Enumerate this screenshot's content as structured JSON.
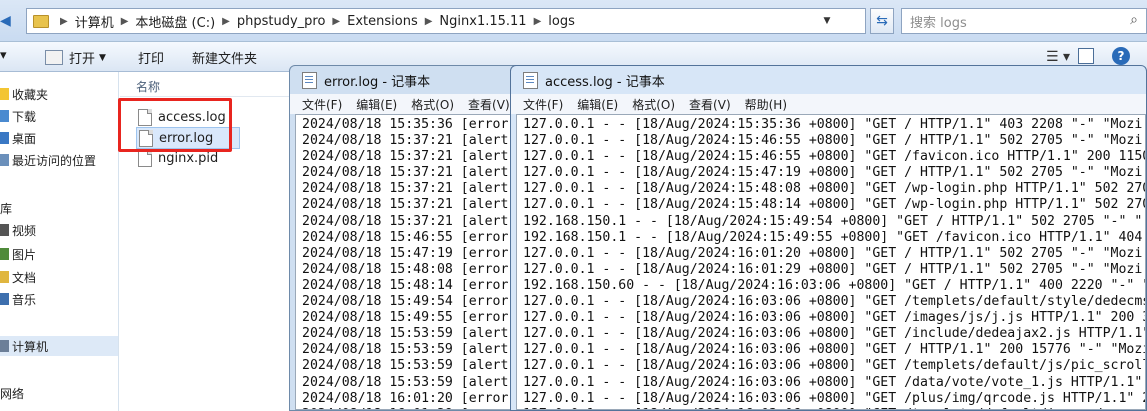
{
  "explorer": {
    "breadcrumb": [
      "计算机",
      "本地磁盘 (C:)",
      "phpstudy_pro",
      "Extensions",
      "Nginx1.15.11",
      "logs"
    ],
    "search_placeholder": "搜索 logs",
    "toolbar": {
      "open": "打开",
      "print": "打印",
      "new_folder": "新建文件夹"
    },
    "nav": {
      "favorites": "收藏夹",
      "downloads": "下载",
      "desktop": "桌面",
      "recent": "最近访问的位置",
      "libraries": "库",
      "videos": "视频",
      "pictures": "图片",
      "documents": "文档",
      "music": "音乐",
      "computer": "计算机",
      "network": "网络"
    },
    "column_name": "名称",
    "files": [
      "access.log",
      "error.log",
      "nginx.pid"
    ],
    "selected_file": "error.log"
  },
  "error_window": {
    "title": "error.log - 记事本",
    "menu": [
      "文件(F)",
      "编辑(E)",
      "格式(O)",
      "查看(V)"
    ],
    "lines": [
      "2024/08/18 15:35:36 [error]",
      "2024/08/18 15:37:21 [alert]",
      "2024/08/18 15:37:21 [alert]",
      "2024/08/18 15:37:21 [alert]",
      "2024/08/18 15:37:21 [alert]",
      "2024/08/18 15:37:21 [alert]",
      "2024/08/18 15:37:21 [alert]",
      "2024/08/18 15:46:55 [error]",
      "2024/08/18 15:47:19 [error]",
      "2024/08/18 15:48:08 [error]",
      "2024/08/18 15:48:14 [error]",
      "2024/08/18 15:49:54 [error]",
      "2024/08/18 15:49:55 [error]",
      "2024/08/18 15:53:59 [alert]",
      "2024/08/18 15:53:59 [alert]",
      "2024/08/18 15:53:59 [alert]",
      "2024/08/18 15:53:59 [alert]",
      "2024/08/18 16:01:20 [error]",
      "2024/08/18 16:01:29 [error]"
    ]
  },
  "access_window": {
    "title": "access.log - 记事本",
    "menu": [
      "文件(F)",
      "编辑(E)",
      "格式(O)",
      "查看(V)",
      "帮助(H)"
    ],
    "lines": [
      "127.0.0.1 - - [18/Aug/2024:15:35:36 +0800] \"GET / HTTP/1.1\" 403 2208 \"-\" \"Mozi",
      "127.0.0.1 - - [18/Aug/2024:15:46:55 +0800] \"GET / HTTP/1.1\" 502 2705 \"-\" \"Mozi",
      "127.0.0.1 - - [18/Aug/2024:15:46:55 +0800] \"GET /favicon.ico HTTP/1.1\" 200 1150",
      "127.0.0.1 - - [18/Aug/2024:15:47:19 +0800] \"GET / HTTP/1.1\" 502 2705 \"-\" \"Mozi",
      "127.0.0.1 - - [18/Aug/2024:15:48:08 +0800] \"GET /wp-login.php HTTP/1.1\" 502 270",
      "127.0.0.1 - - [18/Aug/2024:15:48:14 +0800] \"GET /wp-login.php HTTP/1.1\" 502 270",
      "192.168.150.1 - - [18/Aug/2024:15:49:54 +0800] \"GET / HTTP/1.1\" 502 2705 \"-\" \"",
      "192.168.150.1 - - [18/Aug/2024:15:49:55 +0800] \"GET /favicon.ico HTTP/1.1\" 404",
      "127.0.0.1 - - [18/Aug/2024:16:01:20 +0800] \"GET / HTTP/1.1\" 502 2705 \"-\" \"Mozi",
      "127.0.0.1 - - [18/Aug/2024:16:01:29 +0800] \"GET / HTTP/1.1\" 502 2705 \"-\" \"Mozi",
      "192.168.150.60 - - [18/Aug/2024:16:03:06 +0800] \"GET / HTTP/1.1\" 400 2220 \"-\" \"",
      "127.0.0.1 - - [18/Aug/2024:16:03:06 +0800] \"GET /templets/default/style/dedecms",
      "127.0.0.1 - - [18/Aug/2024:16:03:06 +0800] \"GET /images/js/j.js HTTP/1.1\" 200 3",
      "127.0.0.1 - - [18/Aug/2024:16:03:06 +0800] \"GET /include/dedeajax2.js HTTP/1.1\"",
      "127.0.0.1 - - [18/Aug/2024:16:03:06 +0800] \"GET / HTTP/1.1\" 200 15776 \"-\" \"Mozi",
      "127.0.0.1 - - [18/Aug/2024:16:03:06 +0800] \"GET /templets/default/js/pic_scroll",
      "127.0.0.1 - - [18/Aug/2024:16:03:06 +0800] \"GET /data/vote/vote_1.js HTTP/1.1\"",
      "127.0.0.1 - - [18/Aug/2024:16:03:06 +0800] \"GET /plus/img/qrcode.js HTTP/1.1\" 2",
      "127.0.0.1 - - [18/Aug/2024:16:03:06 +0800] \"GET /templets/default/images/"
    ]
  }
}
